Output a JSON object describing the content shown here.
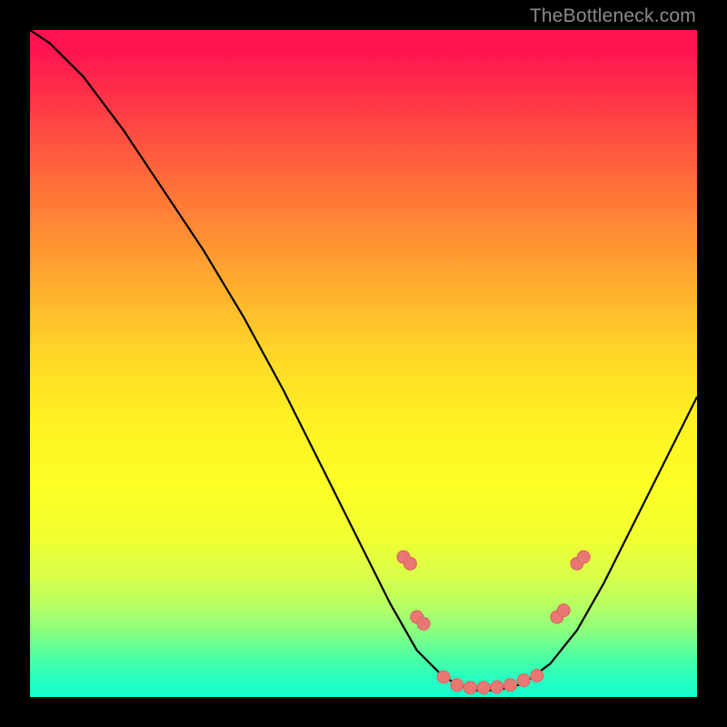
{
  "watermark": "TheBottleneck.com",
  "chart_data": {
    "type": "line",
    "title": "",
    "xlabel": "",
    "ylabel": "",
    "xlim": [
      0,
      100
    ],
    "ylim": [
      0,
      100
    ],
    "curve": [
      {
        "x": 0,
        "y": 100
      },
      {
        "x": 3,
        "y": 98
      },
      {
        "x": 8,
        "y": 93
      },
      {
        "x": 14,
        "y": 85
      },
      {
        "x": 20,
        "y": 76
      },
      {
        "x": 26,
        "y": 67
      },
      {
        "x": 32,
        "y": 57
      },
      {
        "x": 38,
        "y": 46
      },
      {
        "x": 44,
        "y": 34
      },
      {
        "x": 50,
        "y": 22
      },
      {
        "x": 54,
        "y": 14
      },
      {
        "x": 58,
        "y": 7
      },
      {
        "x": 62,
        "y": 3
      },
      {
        "x": 66,
        "y": 1
      },
      {
        "x": 70,
        "y": 1
      },
      {
        "x": 74,
        "y": 2
      },
      {
        "x": 78,
        "y": 5
      },
      {
        "x": 82,
        "y": 10
      },
      {
        "x": 86,
        "y": 17
      },
      {
        "x": 90,
        "y": 25
      },
      {
        "x": 94,
        "y": 33
      },
      {
        "x": 98,
        "y": 41
      },
      {
        "x": 100,
        "y": 45
      }
    ],
    "markers": [
      {
        "x": 56,
        "y": 21
      },
      {
        "x": 57,
        "y": 20
      },
      {
        "x": 58,
        "y": 12
      },
      {
        "x": 59,
        "y": 11
      },
      {
        "x": 62,
        "y": 3
      },
      {
        "x": 64,
        "y": 1.8
      },
      {
        "x": 66,
        "y": 1.4
      },
      {
        "x": 68,
        "y": 1.4
      },
      {
        "x": 70,
        "y": 1.5
      },
      {
        "x": 72,
        "y": 1.8
      },
      {
        "x": 74,
        "y": 2.5
      },
      {
        "x": 76,
        "y": 3.2
      },
      {
        "x": 79,
        "y": 12
      },
      {
        "x": 80,
        "y": 13
      },
      {
        "x": 82,
        "y": 20
      },
      {
        "x": 83,
        "y": 21
      }
    ]
  }
}
